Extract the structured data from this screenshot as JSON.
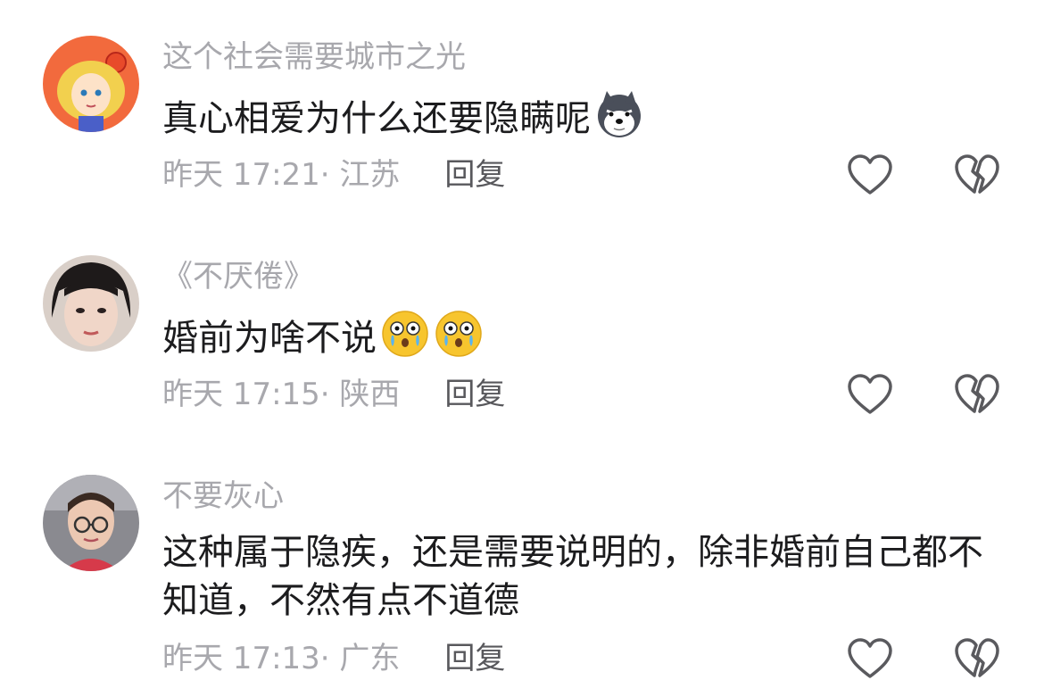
{
  "comments": [
    {
      "username": "这个社会需要城市之光",
      "text": "真心相爱为什么还要隐瞒呢",
      "emojis": [
        "husky-face-icon"
      ],
      "time": "昨天 17:21",
      "location": "江苏",
      "reply_label": "回复"
    },
    {
      "username": "《不厌倦》",
      "text": "婚前为啥不说",
      "emojis": [
        "teary-face-icon",
        "teary-face-icon"
      ],
      "time": "昨天 17:15",
      "location": "陕西",
      "reply_label": "回复"
    },
    {
      "username": "不要灰心",
      "text": "这种属于隐疾，还是需要说明的，除非婚前自己都不知道，不然有点不道德",
      "emojis": [],
      "time": "昨天 17:13",
      "location": "广东",
      "reply_label": "回复"
    }
  ],
  "meta_separator": "· ",
  "icons": {
    "like": "heart-outline-icon",
    "dislike": "broken-heart-outline-icon"
  },
  "colors": {
    "username": "#a8a8ad",
    "text": "#1c1c1e",
    "reply": "#58585c",
    "icon_stroke": "#5a5a5e"
  }
}
